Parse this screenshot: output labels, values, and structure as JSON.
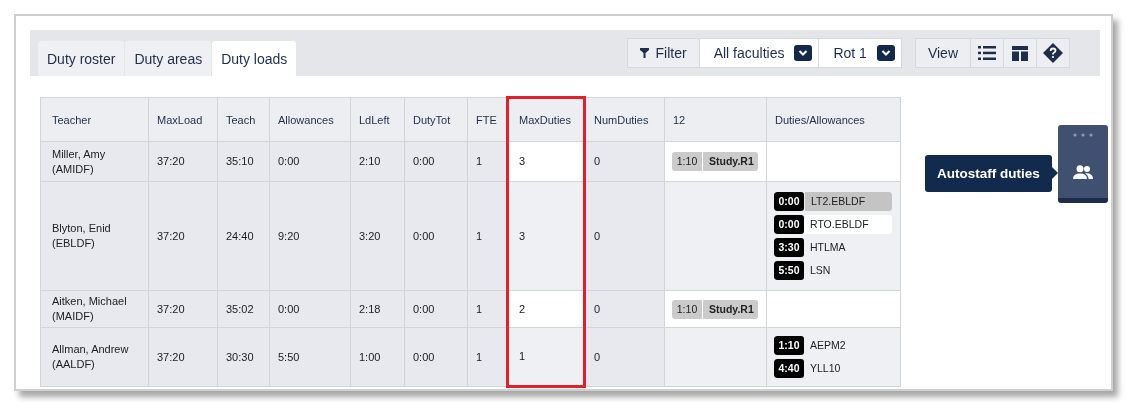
{
  "tabs": [
    {
      "label": "Duty roster",
      "selected": false
    },
    {
      "label": "Duty areas",
      "selected": false
    },
    {
      "label": "Duty loads",
      "selected": true
    }
  ],
  "toolbar": {
    "filter_button": "Filter",
    "faculty_dropdown": "All faculties",
    "rotation_dropdown": "Rot 1",
    "view_button": "View"
  },
  "table": {
    "columns": [
      {
        "label": "Teacher",
        "editable": false,
        "highlighted": false
      },
      {
        "label": "MaxLoad",
        "editable": false,
        "highlighted": false
      },
      {
        "label": "Teach",
        "editable": false,
        "highlighted": false
      },
      {
        "label": "Allowances",
        "editable": false,
        "highlighted": false
      },
      {
        "label": "LdLeft",
        "editable": false,
        "highlighted": false
      },
      {
        "label": "DutyTot",
        "editable": false,
        "highlighted": false
      },
      {
        "label": "FTE",
        "editable": false,
        "highlighted": false
      },
      {
        "label": "MaxDuties",
        "editable": true,
        "highlighted": true
      },
      {
        "label": "NumDuties",
        "editable": false,
        "highlighted": false
      },
      {
        "label": "12",
        "editable": true,
        "highlighted": false
      },
      {
        "label": "Duties/Allowances",
        "editable": true,
        "highlighted": false
      }
    ],
    "rows": [
      {
        "shaded": false,
        "cells": [
          "Miller, Amy (AMIDF)",
          "37:20",
          "35:10",
          "0:00",
          "2:10",
          "0:00",
          "1",
          "3",
          "0"
        ],
        "period_12": [
          {
            "time": "1:10",
            "label": "Study.R1",
            "kind": "pill"
          }
        ],
        "duties": []
      },
      {
        "shaded": true,
        "cells": [
          "Blyton, Enid (EBLDF)",
          "37:20",
          "24:40",
          "9:20",
          "3:20",
          "0:00",
          "1",
          "3",
          "0"
        ],
        "period_12": [],
        "duties": [
          {
            "time": "0:00",
            "label": "LT2.EBLDF",
            "kind": "tagged"
          },
          {
            "time": "0:00",
            "label": "RTO.EBLDF",
            "kind": "boxed"
          },
          {
            "time": "3:30",
            "label": "HTLMA",
            "kind": "plain"
          },
          {
            "time": "5:50",
            "label": "LSN",
            "kind": "plain"
          }
        ]
      },
      {
        "shaded": false,
        "cells": [
          "Aitken, Michael (MAIDF)",
          "37:20",
          "35:02",
          "0:00",
          "2:18",
          "0:00",
          "1",
          "2",
          "0"
        ],
        "period_12": [
          {
            "time": "1:10",
            "label": "Study.R1",
            "kind": "pill"
          }
        ],
        "duties": []
      },
      {
        "shaded": true,
        "cells": [
          "Allman, Andrew (AALDF)",
          "37:20",
          "30:30",
          "5:50",
          "1:00",
          "0:00",
          "1",
          "1",
          "0"
        ],
        "period_12": [],
        "duties": [
          {
            "time": "1:10",
            "label": "AEPM2",
            "kind": "plain"
          },
          {
            "time": "4:40",
            "label": "YLL10",
            "kind": "plain"
          }
        ]
      }
    ]
  },
  "autostaff": {
    "tooltip": "Autostaff duties"
  }
}
